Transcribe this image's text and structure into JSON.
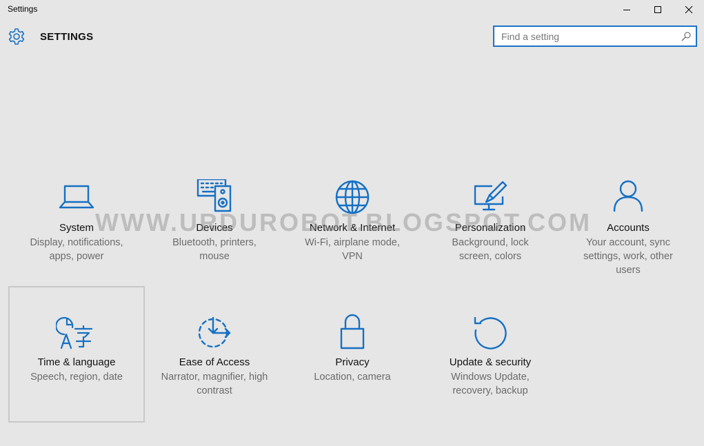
{
  "window": {
    "title": "Settings",
    "minimize_icon": "minimize-icon",
    "maximize_icon": "maximize-icon",
    "close_icon": "close-icon"
  },
  "header": {
    "icon": "gear-icon",
    "title": "SETTINGS"
  },
  "search": {
    "placeholder": "Find a setting",
    "value": "",
    "icon": "search-icon"
  },
  "accent_color": "#1570c4",
  "watermark": "WWW.URDUROBOT.BLOGSPOT.COM",
  "tiles": [
    {
      "name": "System",
      "description": "Display, notifications, apps, power",
      "icon": "laptop-icon"
    },
    {
      "name": "Devices",
      "description": "Bluetooth, printers, mouse",
      "icon": "devices-icon"
    },
    {
      "name": "Network & Internet",
      "description": "Wi-Fi, airplane mode, VPN",
      "icon": "globe-icon"
    },
    {
      "name": "Personalization",
      "description": "Background, lock screen, colors",
      "icon": "paintbrush-icon"
    },
    {
      "name": "Accounts",
      "description": "Your account, sync settings, work, other users",
      "icon": "person-icon"
    },
    {
      "name": "Time & language",
      "description": "Speech, region, date",
      "icon": "time-language-icon",
      "selected": true
    },
    {
      "name": "Ease of Access",
      "description": "Narrator, magnifier, high contrast",
      "icon": "ease-of-access-icon"
    },
    {
      "name": "Privacy",
      "description": "Location, camera",
      "icon": "lock-icon"
    },
    {
      "name": "Update & security",
      "description": "Windows Update, recovery, backup",
      "icon": "refresh-icon"
    }
  ]
}
